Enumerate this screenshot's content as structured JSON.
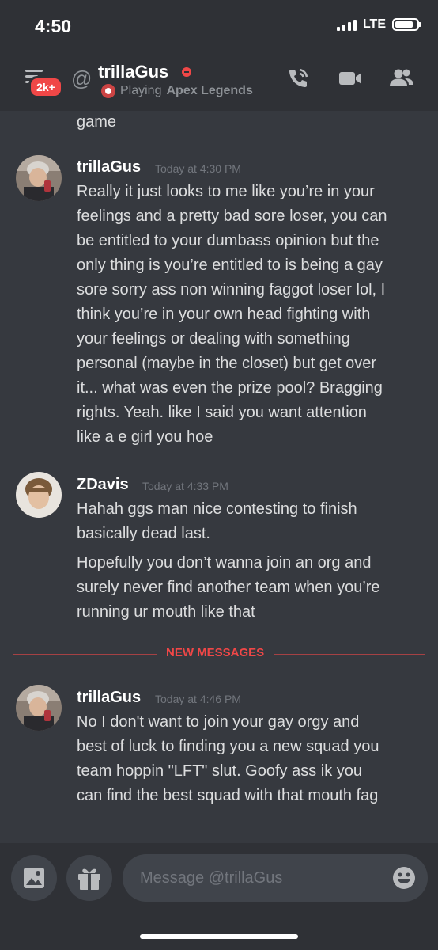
{
  "status_bar": {
    "time": "4:50",
    "network": "LTE"
  },
  "header": {
    "unread_badge": "2k+",
    "at_symbol": "@",
    "channel_name": "trillaGus",
    "activity_prefix": "Playing",
    "activity_game": "Apex Legends",
    "icons": [
      "call-icon",
      "video-icon",
      "members-icon"
    ]
  },
  "messages": {
    "prev_continuation": "game",
    "groups": [
      {
        "author": "trillaGus",
        "timestamp": "Today at 4:30 PM",
        "lines": [
          "Really it just looks to me like you’re in your",
          "feelings and a pretty bad sore loser, you can",
          "be entitled to your dumbass opinion but the",
          "only thing is you’re entitled to is being a  gay",
          "sore sorry ass non winning faggot loser lol, I",
          "think you’re in your own head fighting with",
          "your feelings or dealing with something",
          "personal (maybe in the closet) but get over",
          "it... what was even the prize pool? Bragging",
          "rights. Yeah. like I said you want attention",
          "like a e girl you hoe"
        ]
      },
      {
        "author": "ZDavis",
        "timestamp": "Today at 4:33 PM",
        "lines": [
          "Hahah ggs man nice contesting to finish",
          "basically dead last."
        ],
        "lines2": [
          "Hopefully you don’t wanna join an org and",
          "surely never find another team when you’re",
          "running ur mouth like that"
        ]
      },
      {
        "author": "trillaGus",
        "timestamp": "Today at 4:46 PM",
        "lines": [
          "No I don't want to join your gay orgy and",
          "best of luck to finding you a new squad you",
          "team hoppin \"LFT\" slut.  Goofy ass ik you",
          "can find the best squad with that mouth fag"
        ]
      }
    ],
    "new_messages_label": "NEW MESSAGES"
  },
  "composer": {
    "placeholder": "Message @trillaGus",
    "icons": [
      "image-icon",
      "gift-icon",
      "emoji-icon"
    ]
  },
  "colors": {
    "background": "#36393f",
    "header": "#2f3136",
    "accent_red": "#f04747",
    "text": "#dcddde",
    "muted": "#72767d"
  }
}
